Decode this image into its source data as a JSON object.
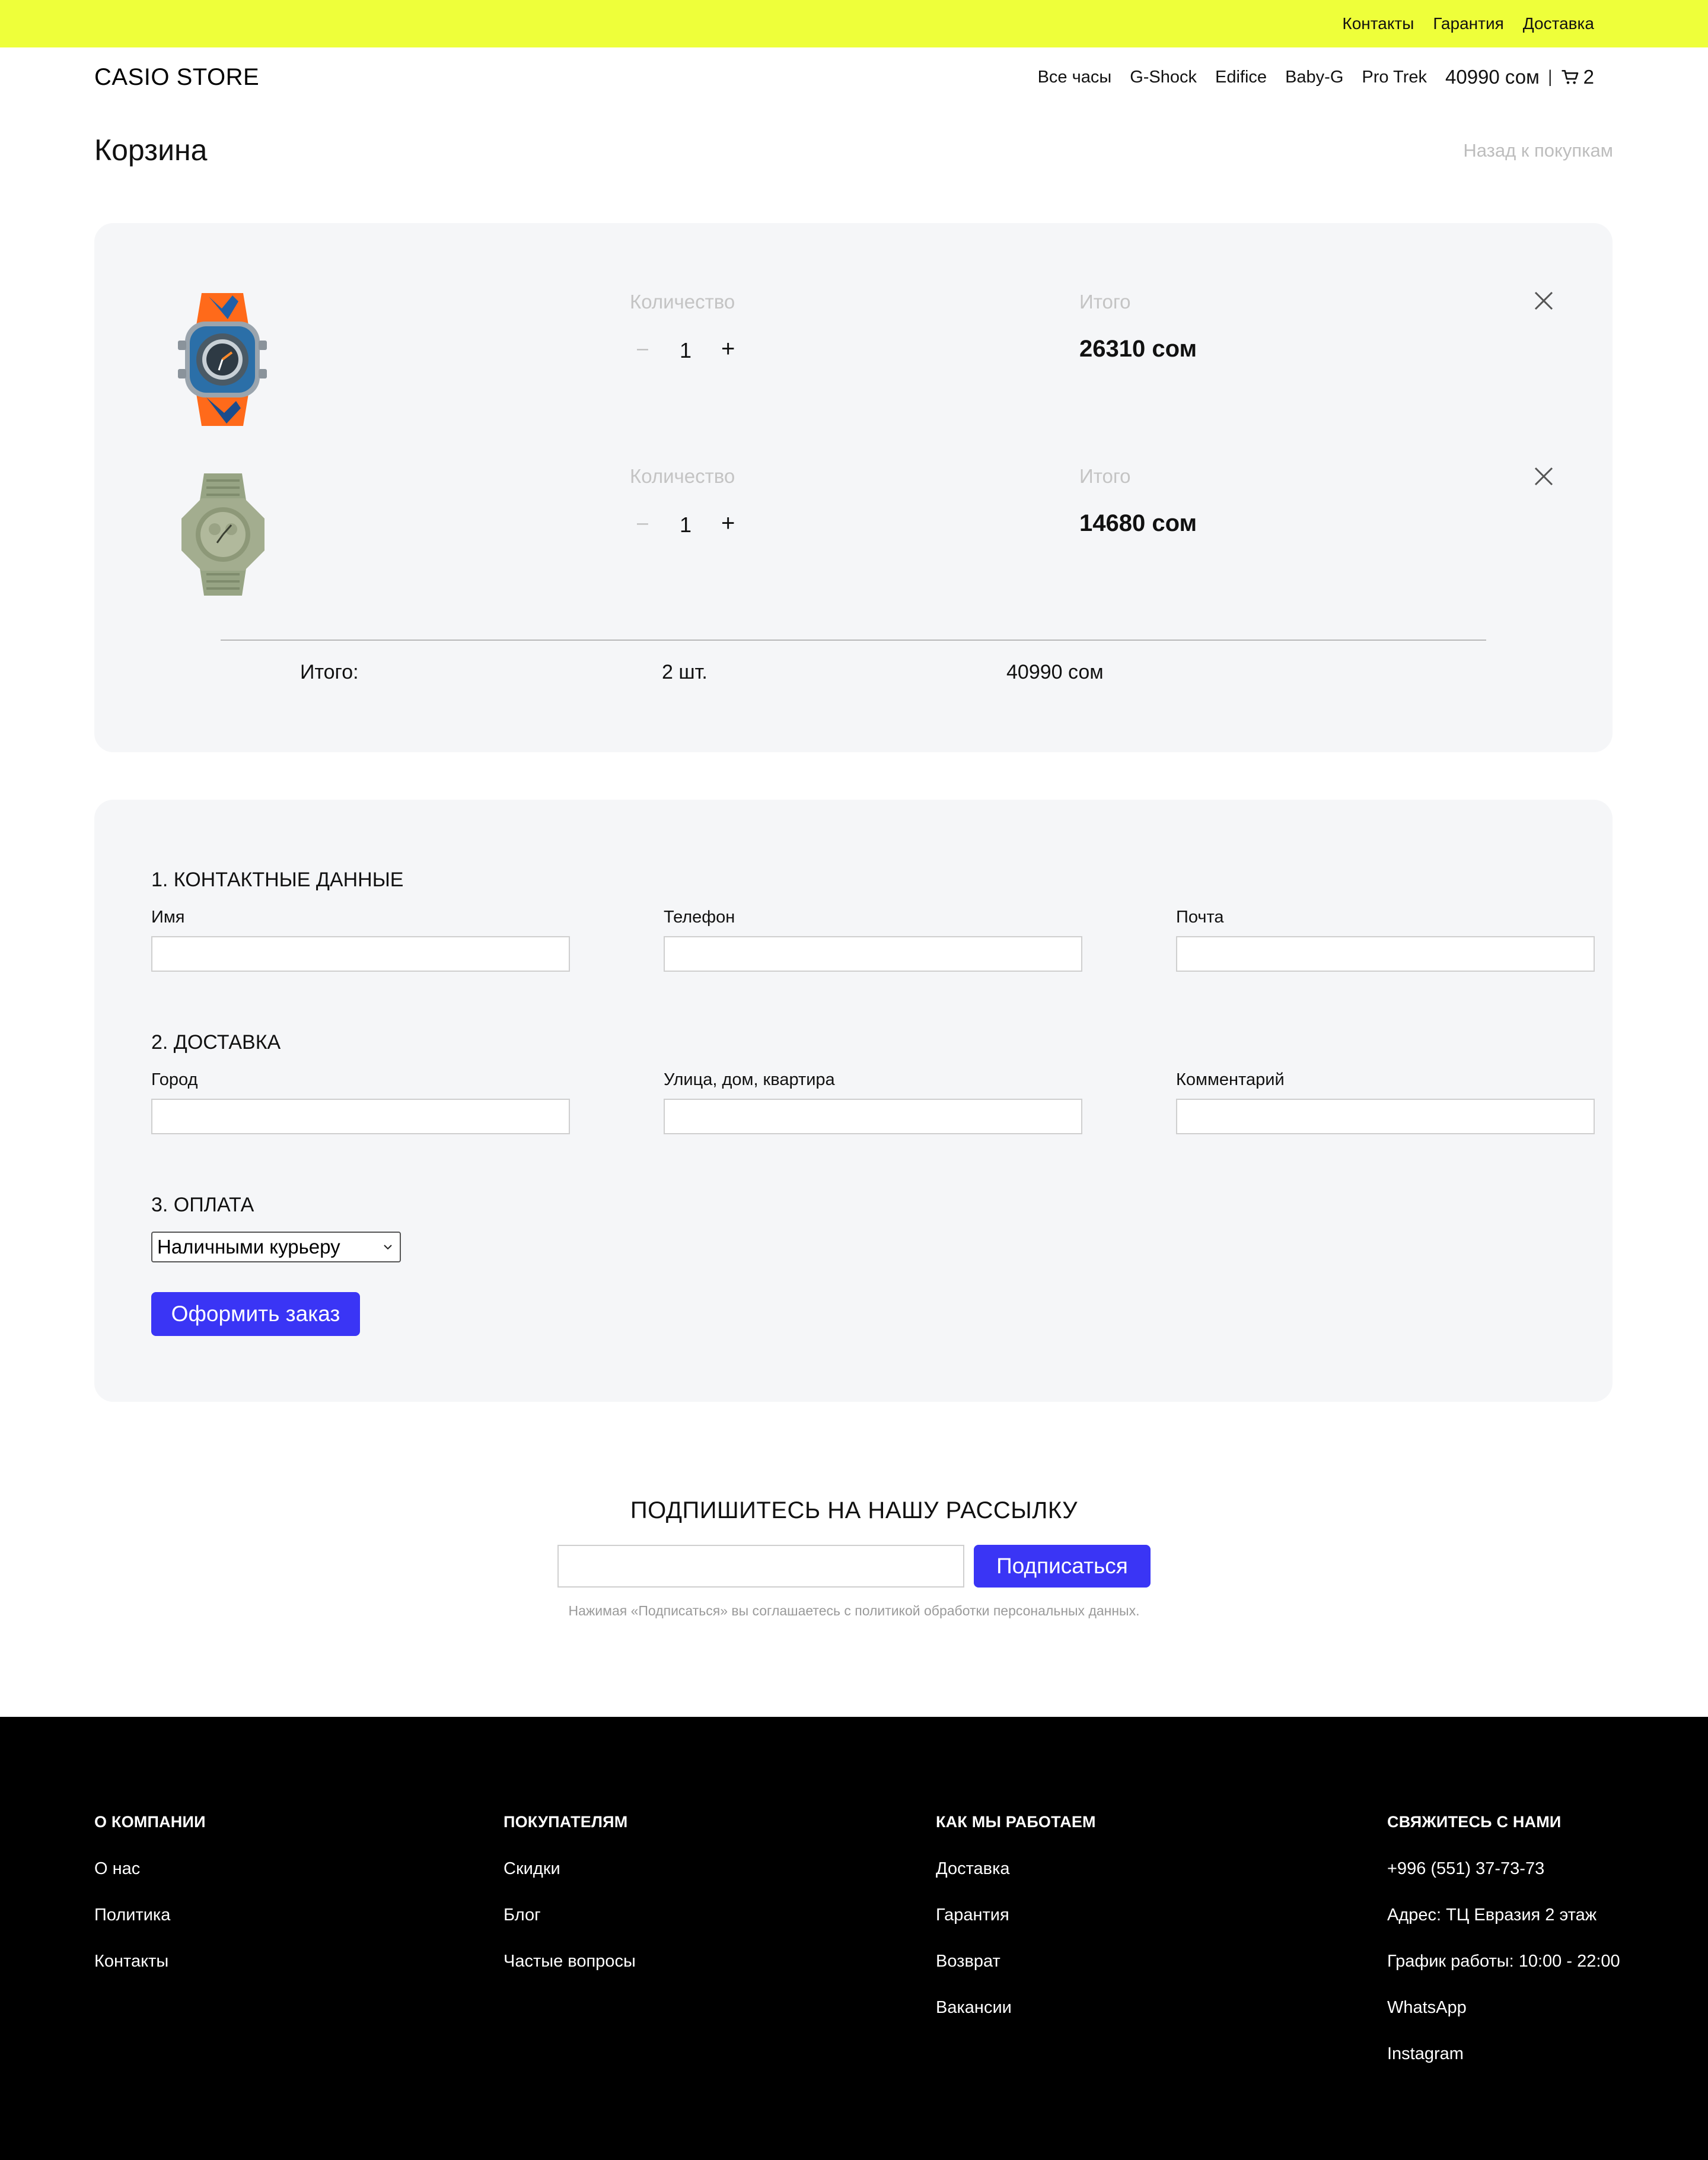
{
  "topbar": {
    "links": [
      "Контакты",
      "Гарантия",
      "Доставка"
    ]
  },
  "header": {
    "logo": "CASIO STORE",
    "nav": [
      "Все часы",
      "G-Shock",
      "Edifice",
      "Baby-G",
      "Pro Trek"
    ],
    "cart_sum": "40990 сом",
    "separator": "|",
    "cart_count": "2"
  },
  "page": {
    "title": "Корзина",
    "back_link": "Назад к покупкам"
  },
  "cart": {
    "items": [
      {
        "qty_label": "Количество",
        "minus": "–",
        "qty": "1",
        "plus": "+",
        "total_label": "Итого",
        "total": "26310 сом",
        "image": "watch-gshock-orange-blue"
      },
      {
        "qty_label": "Количество",
        "minus": "–",
        "qty": "1",
        "plus": "+",
        "total_label": "Итого",
        "total": "14680 сом",
        "image": "watch-gshock-olive"
      }
    ],
    "summary": {
      "label": "Итого:",
      "qty": "2 шт.",
      "total": "40990 сом"
    }
  },
  "checkout": {
    "contact_title": "1. КОНТАКТНЫЕ ДАННЫЕ",
    "contact_fields": [
      "Имя",
      "Телефон",
      "Почта"
    ],
    "delivery_title": "2. ДОСТАВКА",
    "delivery_fields": [
      "Город",
      "Улица, дом, квартира",
      "Комментарий"
    ],
    "payment_title": "3. ОПЛАТА",
    "payment_selected": "Наличными курьеру",
    "submit": "Оформить заказ"
  },
  "newsletter": {
    "title": "ПОДПИШИТЕСЬ НА НАШУ РАССЫЛКУ",
    "button": "Подписаться",
    "note": "Нажимая «Подписаться» вы соглашаетесь с политикой обработки персональных данных."
  },
  "footer": {
    "columns": [
      {
        "title": "О КОМПАНИИ",
        "links": [
          "О нас",
          "Политика",
          "Контакты"
        ]
      },
      {
        "title": "ПОКУПАТЕЛЯМ",
        "links": [
          "Скидки",
          "Блог",
          "Частые вопросы"
        ]
      },
      {
        "title": "КАК МЫ РАБОТАЕМ",
        "links": [
          "Доставка",
          "Гарантия",
          "Возврат",
          "Вакансии"
        ]
      },
      {
        "title": "СВЯЖИТЕСЬ С НАМИ",
        "links": [
          "+996 (551) 37-73-73",
          "Адрес: ТЦ Евразия 2 этаж",
          "График работы: 10:00 - 22:00",
          "WhatsApp",
          "Instagram"
        ]
      }
    ]
  },
  "colors": {
    "topbar": "#eeff3a",
    "accent": "#3a35f5",
    "card": "#f5f6f8",
    "footer": "#000000"
  }
}
